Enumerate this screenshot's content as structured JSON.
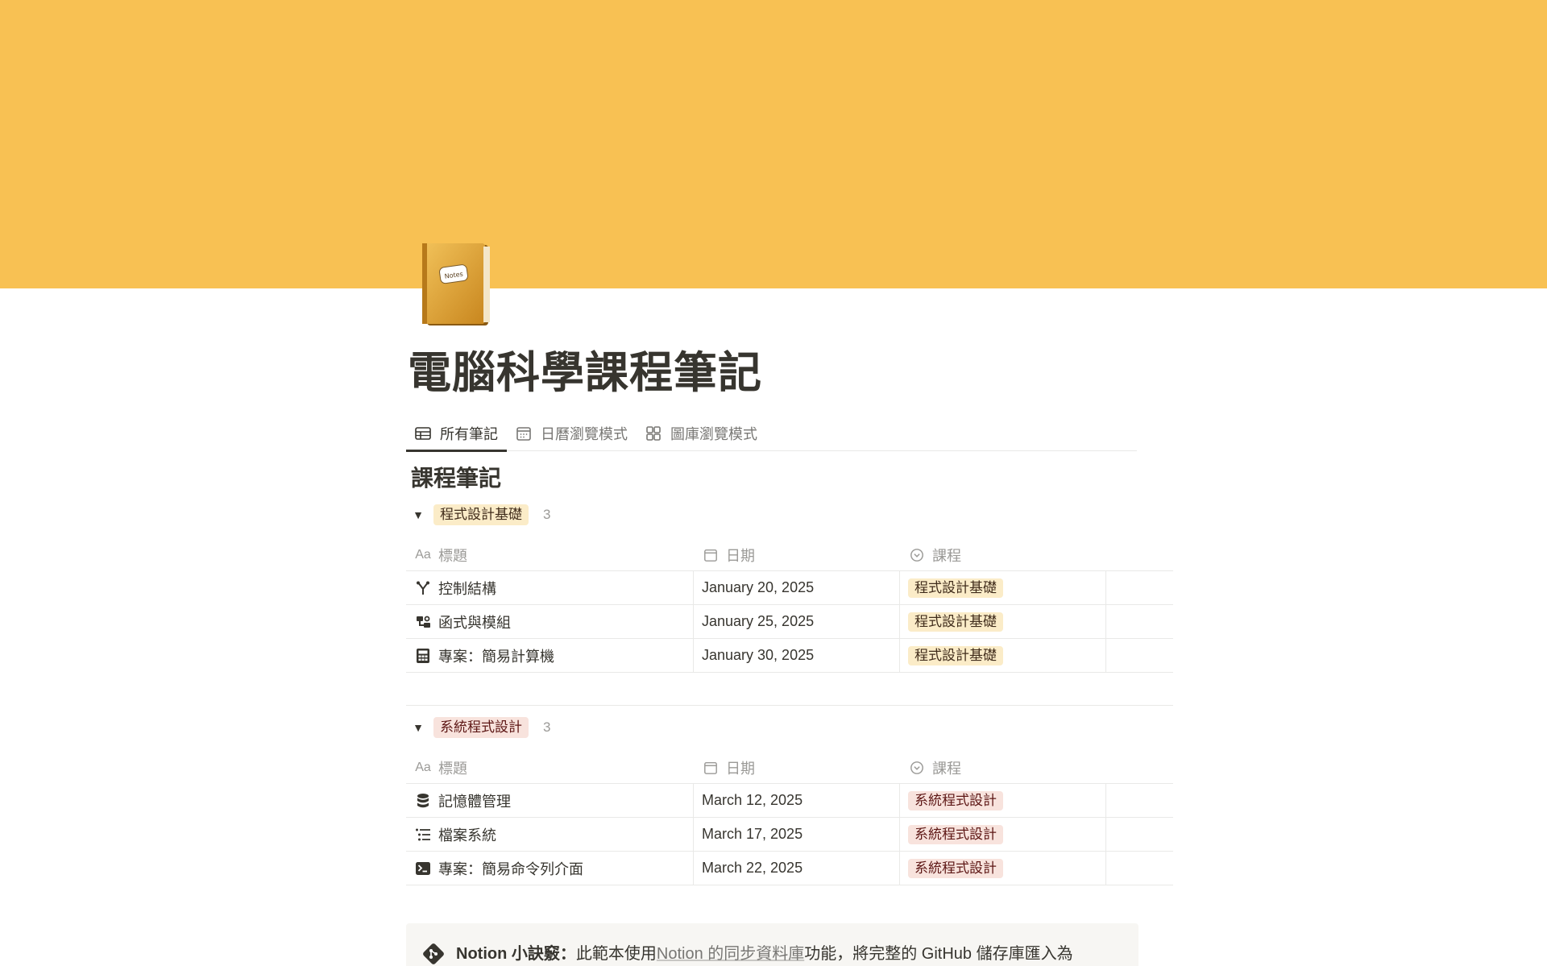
{
  "colors": {
    "cover": "#f8c153",
    "tag_yellow_bg": "#fbecc8",
    "tag_red_bg": "#f8e3dd"
  },
  "page": {
    "title": "電腦科學課程筆記",
    "icon": "notebook-icon",
    "icon_label": "Notes"
  },
  "tabs": [
    {
      "label": "所有筆記",
      "icon": "table-icon",
      "active": true
    },
    {
      "label": "日曆瀏覽模式",
      "icon": "calendar-icon",
      "active": false
    },
    {
      "label": "圖庫瀏覽模式",
      "icon": "gallery-icon",
      "active": false
    }
  ],
  "database": {
    "title": "課程筆記",
    "columns": {
      "title": "標題",
      "title_icon": "Aa",
      "date": "日期",
      "course": "課程"
    },
    "groups": [
      {
        "name": "程式設計基礎",
        "count": "3",
        "color": "yellow",
        "rows": [
          {
            "title": "控制結構",
            "icon": "branch-icon",
            "date": "January 20, 2025",
            "course": "程式設計基礎"
          },
          {
            "title": "函式與模組",
            "icon": "modules-icon",
            "date": "January 25, 2025",
            "course": "程式設計基礎"
          },
          {
            "title": "專案：簡易計算機",
            "icon": "calculator-icon",
            "date": "January 30, 2025",
            "course": "程式設計基礎"
          }
        ]
      },
      {
        "name": "系統程式設計",
        "count": "3",
        "color": "red",
        "rows": [
          {
            "title": "記憶體管理",
            "icon": "database-icon",
            "date": "March 12, 2025",
            "course": "系統程式設計"
          },
          {
            "title": "檔案系統",
            "icon": "list-icon",
            "date": "March 17, 2025",
            "course": "系統程式設計"
          },
          {
            "title": "專案：簡易命令列介面",
            "icon": "terminal-icon",
            "date": "March 22, 2025",
            "course": "系統程式設計"
          }
        ]
      }
    ]
  },
  "callout": {
    "bold": "Notion 小訣竅：",
    "text_before": "此範本使用",
    "link": "Notion 的同步資料庫",
    "text_after": "功能，將完整的 GitHub 儲存庫匯入為"
  }
}
